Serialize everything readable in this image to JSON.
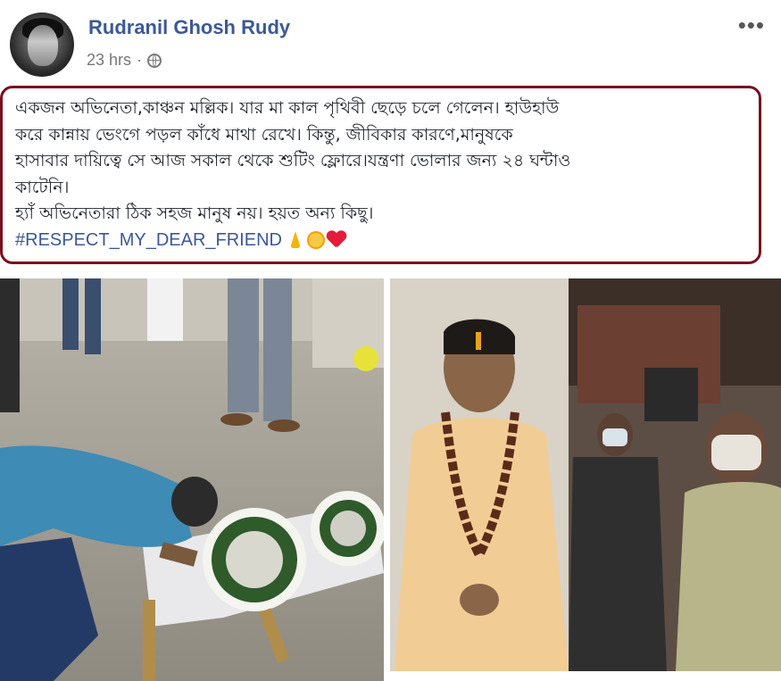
{
  "post": {
    "author": "Rudranil Ghosh Rudy",
    "time": "23 hrs",
    "separator": "·",
    "more_label": "•••",
    "lines": [
      "একজন অভিনেতা,কাঞ্চন মল্লিক। যার মা কাল পৃথিবী ছেড়ে চলে গেলেন। হাউহাউ",
      "করে কান্নায় ভেংগে পড়ল কাঁধে মাথা রেখে। কিন্তু, জীবিকার কারণে,মানুষকে",
      "হাসাবার দায়িত্বে সে আজ সকাল থেকে শুটিং ফ্লোরে।যন্ত্রণা ভোলার জন্য ২৪ ঘন্টাও",
      "কাটেনি।",
      "হ্যাঁ অভিনেতারা ঠিক সহজ মানুষ নয়। হয়ত অন্য কিছু।"
    ],
    "hashtag": "#RESPECT_MY_DEAR_FRIEND",
    "emoji_icons": [
      "folded-hands-icon",
      "sun-icon",
      "heart-icon"
    ],
    "accent_color": "#3b5998",
    "highlight_border_color": "#7a0f1d"
  }
}
